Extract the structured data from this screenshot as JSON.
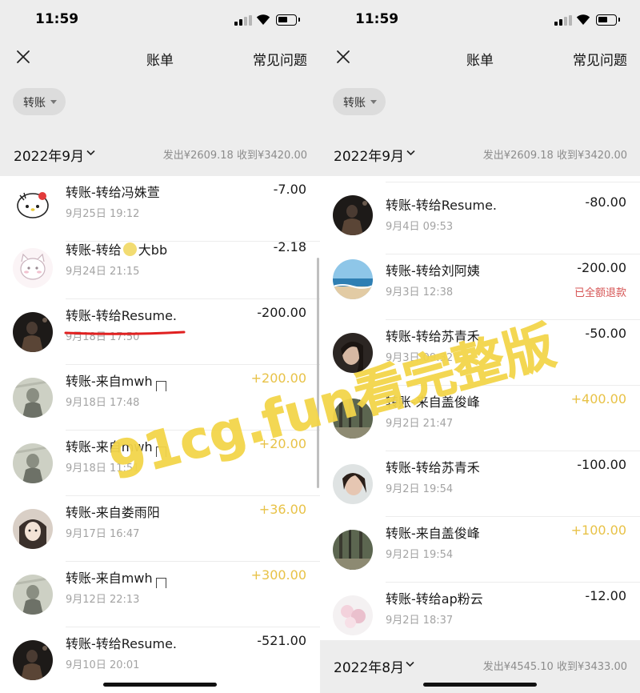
{
  "left": {
    "status": {
      "time": "11:59"
    },
    "nav": {
      "title": "账单",
      "faq": "常见问题"
    },
    "filter": {
      "label": "转账"
    },
    "month": {
      "label": "2022年9月",
      "summary": "发出¥2609.18  收到¥3420.00"
    },
    "rows": [
      {
        "name": "转账-转给冯姝萱",
        "date": "9月25日 19:12",
        "amount": "-7.00",
        "type": "expense",
        "avatar": "hello-kitty"
      },
      {
        "name_before": "转账-转给",
        "name_after": "大bb",
        "date": "9月24日 21:15",
        "amount": "-2.18",
        "type": "expense",
        "avatar": "cartoon-cat"
      },
      {
        "name": "转账-转给Resume.",
        "date": "9月18日 17:50",
        "amount": "-200.00",
        "type": "expense",
        "avatar": "dark-portrait"
      },
      {
        "name": "转账-来自mwh",
        "date": "9月18日 17:48",
        "amount": "+200.00",
        "type": "income",
        "avatar": "grey-photo"
      },
      {
        "name": "转账-来自mwh",
        "date": "9月18日 11:51",
        "amount": "+20.00",
        "type": "income",
        "avatar": "grey-photo"
      },
      {
        "name": "转账-来自娄雨阳",
        "date": "9月17日 16:47",
        "amount": "+36.00",
        "type": "income",
        "avatar": "anime-girl"
      },
      {
        "name": "转账-来自mwh",
        "date": "9月12日 22:13",
        "amount": "+300.00",
        "type": "income",
        "avatar": "grey-photo"
      },
      {
        "name": "转账-转给Resume.",
        "date": "9月10日 20:01",
        "amount": "-521.00",
        "type": "expense",
        "avatar": "dark-portrait"
      }
    ]
  },
  "right": {
    "status": {
      "time": "11:59"
    },
    "nav": {
      "title": "账单",
      "faq": "常见问题"
    },
    "filter": {
      "label": "转账"
    },
    "month": {
      "label": "2022年9月",
      "summary": "发出¥2609.18  收到¥3420.00"
    },
    "rows": [
      {
        "name": "转账-转给Resume.",
        "date": "9月4日 09:53",
        "amount": "-80.00",
        "type": "expense",
        "avatar": "dark-portrait"
      },
      {
        "name": "转账-转给刘阿姨",
        "date": "9月3日 12:38",
        "amount": "-200.00",
        "type": "expense",
        "note": "已全额退款",
        "avatar": "beach"
      },
      {
        "name": "转账-转给苏青禾",
        "date": "9月3日 09:32",
        "amount": "-50.00",
        "type": "expense",
        "avatar": "face-portrait"
      },
      {
        "name": "转账-来自盖俊峰",
        "date": "9月2日 21:47",
        "amount": "+400.00",
        "type": "income",
        "avatar": "forest"
      },
      {
        "name": "转账-转给苏青禾",
        "date": "9月2日 19:54",
        "amount": "-100.00",
        "type": "expense",
        "avatar": "face-portrait"
      },
      {
        "name": "转账-来自盖俊峰",
        "date": "9月2日 19:54",
        "amount": "+100.00",
        "type": "income",
        "avatar": "forest"
      },
      {
        "name": "转账-转给ap粉云",
        "date": "9月2日 18:37",
        "amount": "-12.00",
        "type": "expense",
        "avatar": "flowers"
      }
    ],
    "footer_month": {
      "label": "2022年8月",
      "summary": "发出¥4545.10  收到¥3433.00"
    }
  },
  "watermark": {
    "text": "91cg.fun看完整版"
  },
  "colors": {
    "income": "#e8c247",
    "refund": "#d65454",
    "underline": "#e02020",
    "header_bg": "#ededed"
  }
}
